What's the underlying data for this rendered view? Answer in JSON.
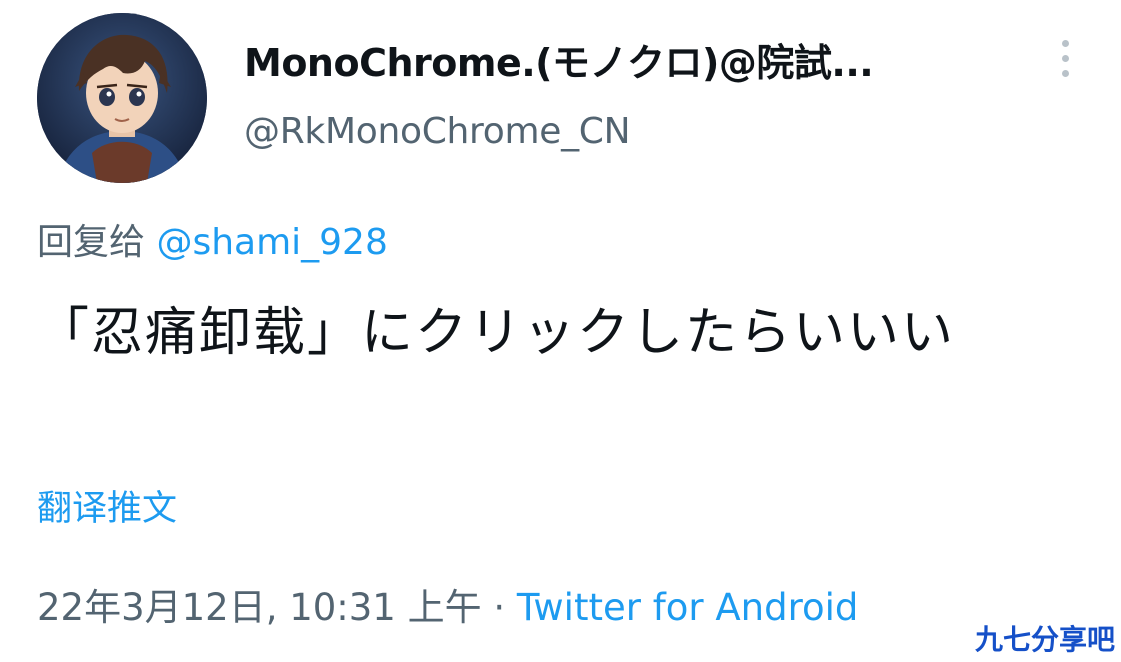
{
  "author": {
    "display_name": "MonoChrome.(モノクロ)@院試...",
    "handle": "@RkMonoChrome_CN",
    "avatar_icon": "anime-avatar-icon"
  },
  "more_icon": "more-vertical-icon",
  "reply": {
    "prefix": "回复给 ",
    "mention": "@shami_928"
  },
  "tweet": {
    "text": "「忍痛卸载」にクリックしたらいいい"
  },
  "translate_label": "翻译推文",
  "meta": {
    "timestamp": "22年3月12日, 10:31 上午",
    "separator": " · ",
    "source": "Twitter for Android"
  },
  "watermark": "九七分享吧",
  "colors": {
    "link": "#1d9bf0",
    "secondary_text": "#536471",
    "primary_text": "#0f1419",
    "watermark": "#1550c8"
  }
}
